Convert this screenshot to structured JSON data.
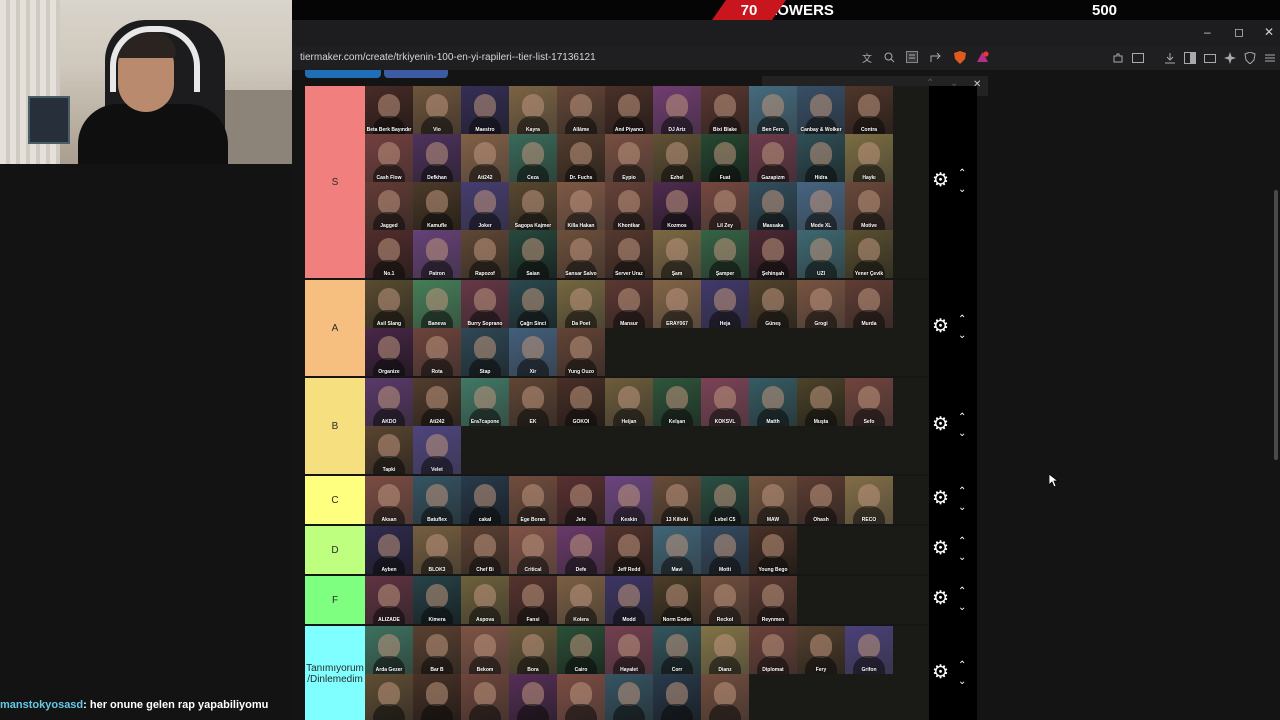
{
  "followers": {
    "current": "70",
    "label": "FOLLOWERS",
    "goal": "500"
  },
  "browser": {
    "url": "tiermaker.com/create/trkiyenin-100-en-yi-rapileri--tier-list-17136121",
    "minimize": "–",
    "restore": "◻",
    "close": "✕",
    "find_up": "⌃",
    "find_down": "⌄",
    "find_close": "✕"
  },
  "tiers": [
    {
      "label": "S",
      "color": "#f17f7e",
      "items": [
        "Beta Berk Bayındır",
        "Vio",
        "Maestro",
        "Kayra",
        "Allâme",
        "Anıl Piyancı",
        "DJ Artz",
        "Bixi Blake",
        "Ben Fero",
        "Canbay & Wolker",
        "Contra",
        "Cash Flow",
        "Defkhan",
        "Ati242",
        "Ceza",
        "Dr. Fuchs",
        "Eypio",
        "Ezhel",
        "Fuat",
        "Gazapizm",
        "Hidra",
        "Haykı",
        "Jagged",
        "Kamufle",
        "Joker",
        "Sagopa Kajmer",
        "Killa Hakan",
        "Khontkar",
        "Kozmos",
        "Lil Zey",
        "Massaka",
        "Mode XL",
        "Motive",
        "No.1",
        "Patron",
        "Rapozof",
        "Saian",
        "Sansar Salvo",
        "Server Uraz",
        "Şam",
        "Şamper",
        "Şehinşah",
        "UZI",
        "Yener Çevik"
      ]
    },
    {
      "label": "A",
      "color": "#f6bf7f",
      "items": [
        "Asil Slang",
        "Baneva",
        "Burry Soprano",
        "Çağrı Sinci",
        "Da Poet",
        "Mansur",
        "ERAY067",
        "Heja",
        "Güneş",
        "Grogi",
        "Murda",
        "Organize",
        "Rota",
        "Stap",
        "Xir",
        "Yung Ouzo"
      ]
    },
    {
      "label": "B",
      "color": "#f6df7f",
      "items": [
        "AKDO",
        "Ati242",
        "Era7capone",
        "EK",
        "GOKOI",
        "Heijan",
        "Kelşan",
        "KÖKSVL",
        "Matth",
        "Muşta",
        "Sefo",
        "Tapki",
        "Velet"
      ]
    },
    {
      "label": "C",
      "color": "#fefe7f",
      "items": [
        "Aksan",
        "Batuflex",
        "cakal",
        "Ege Boran",
        "Jefe",
        "Keskin",
        "13 Killoki",
        "Lvbel C5",
        "MAW",
        "Ohash",
        "RECO"
      ]
    },
    {
      "label": "D",
      "color": "#bfff7f",
      "items": [
        "Ayben",
        "BLOK3",
        "Chef Bi",
        "Critical",
        "Defe",
        "Jeff Redd",
        "Mavi",
        "Motti",
        "Young Bego"
      ]
    },
    {
      "label": "F",
      "color": "#7fff7f",
      "items": [
        "ALIZADE",
        "Kimera",
        "Aspova",
        "Fansi",
        "Kolera",
        "Modd",
        "Norm Ender",
        "Reckol",
        "Reynmen"
      ]
    },
    {
      "label": "Tanımıyorum /Dinlemedim",
      "color": "#7fffff",
      "items": [
        "Arda Gezer",
        "Bar B",
        "Bekom",
        "Bora",
        "Cairo",
        "Hayalet",
        "Corr",
        "Dianz",
        "Diplomat",
        "Fery",
        "Grifon",
        "",
        "",
        "",
        "",
        "",
        "",
        "",
        ""
      ]
    }
  ],
  "chat": {
    "user": "manstokyosasd",
    "message": ": her onune gelen rap yapabiliyomu"
  },
  "colors": {
    "accent_red": "#c9151d",
    "chat_user": "#65c8e8"
  }
}
